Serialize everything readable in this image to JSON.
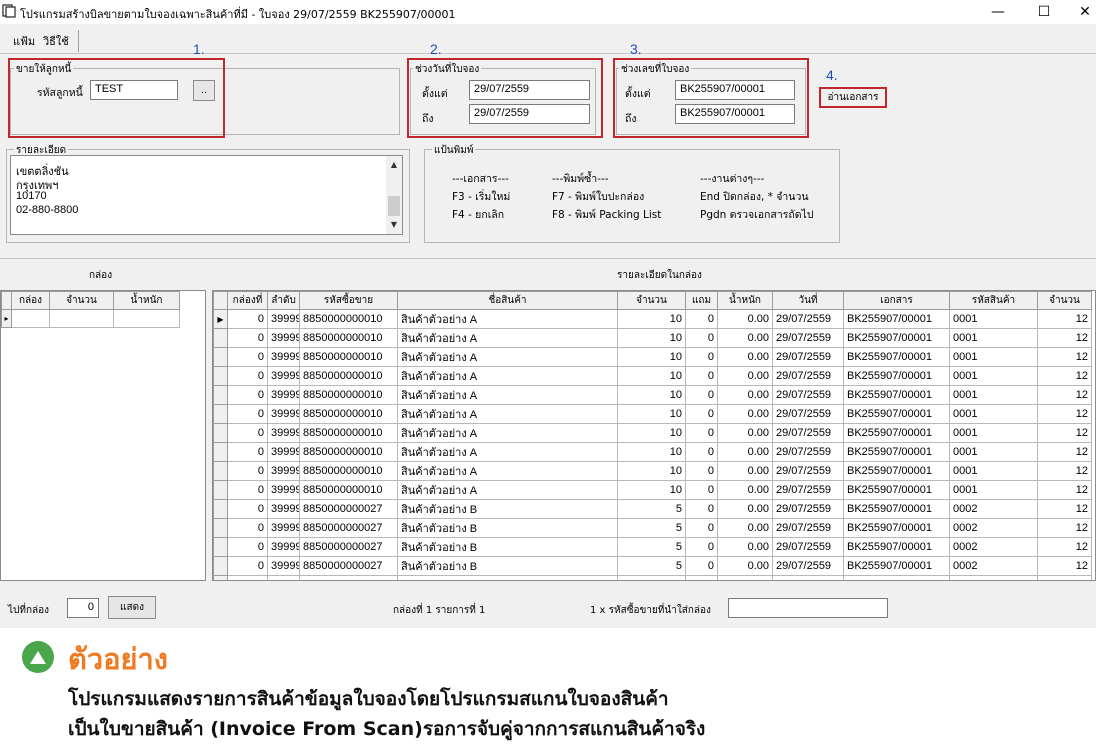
{
  "window": {
    "title": "โปรแกรมสร้างบิลขายตามใบจองเฉพาะสินค้าที่มี - ใบจอง 29/07/2559 BK255907/00001",
    "minimize": "—",
    "maximize": "☐",
    "close": "✕"
  },
  "menu": {
    "file": "แฟ้ม",
    "howto": "วิธีใช้"
  },
  "markers": {
    "m1": "1.",
    "m2": "2.",
    "m3": "3.",
    "m4": "4."
  },
  "customer": {
    "legend": "ขายให้ลูกหนี้",
    "code_label": "รหัสลูกหนี้",
    "code_value": "TEST",
    "browse_label": ".."
  },
  "date_range": {
    "legend": "ช่วงวันที่ใบจอง",
    "from_label": "ตั้งแต่",
    "from_value": "29/07/2559",
    "to_label": "ถึง",
    "to_value": "29/07/2559"
  },
  "doc_range": {
    "legend": "ช่วงเลขที่ใบจอง",
    "from_label": "ตั้งแต่",
    "from_value": "BK255907/00001",
    "to_label": "ถึง",
    "to_value": "BK255907/00001"
  },
  "read_button": "อ่านเอกสาร",
  "detail": {
    "legend": "รายละเอียด",
    "lines": [
      "เขตตลิ่งชัน",
      "กรุงเทพฯ",
      "10170",
      "02-880-8800"
    ]
  },
  "shortcuts": {
    "legend": "แป้นพิมพ์",
    "col1_header": "---เอกสาร---",
    "col1_a": "F3 - เริ่มใหม่",
    "col1_b": "F4 - ยกเลิก",
    "col2_header": "---พิมพ์ซ้ำ---",
    "col2_a": "F7 - พิมพ์ใบปะกล่อง",
    "col2_b": "F8 - พิมพ์ Packing List",
    "col3_header": "---งานต่างๆ---",
    "col3_a": "End ปิดกล่อง, * จำนวน",
    "col3_b": "Pgdn ตรวจเอกสารถัดไป"
  },
  "box_section": {
    "title": "กล่อง",
    "columns": [
      "กล่อง",
      "จำนวน",
      "น้ำหนัก"
    ]
  },
  "detail_section": {
    "title": "รายละเอียดในกล่อง",
    "columns": [
      "กล่องที่",
      "ลำดับ",
      "รหัสซื้อขาย",
      "ชื่อสินค้า",
      "จำนวน",
      "แถม",
      "น้ำหนัก",
      "วันที่",
      "เอกสาร",
      "รหัสสินค้า",
      "จำนวน"
    ],
    "rows": [
      [
        "0",
        "39999",
        "8850000000010",
        "สินค้าตัวอย่าง A",
        "10",
        "0",
        "0.00",
        "29/07/2559",
        "BK255907/00001",
        "0001",
        "12"
      ],
      [
        "0",
        "39999",
        "8850000000010",
        "สินค้าตัวอย่าง A",
        "10",
        "0",
        "0.00",
        "29/07/2559",
        "BK255907/00001",
        "0001",
        "12"
      ],
      [
        "0",
        "39999",
        "8850000000010",
        "สินค้าตัวอย่าง A",
        "10",
        "0",
        "0.00",
        "29/07/2559",
        "BK255907/00001",
        "0001",
        "12"
      ],
      [
        "0",
        "39999",
        "8850000000010",
        "สินค้าตัวอย่าง A",
        "10",
        "0",
        "0.00",
        "29/07/2559",
        "BK255907/00001",
        "0001",
        "12"
      ],
      [
        "0",
        "39999",
        "8850000000010",
        "สินค้าตัวอย่าง A",
        "10",
        "0",
        "0.00",
        "29/07/2559",
        "BK255907/00001",
        "0001",
        "12"
      ],
      [
        "0",
        "39999",
        "8850000000010",
        "สินค้าตัวอย่าง A",
        "10",
        "0",
        "0.00",
        "29/07/2559",
        "BK255907/00001",
        "0001",
        "12"
      ],
      [
        "0",
        "39999",
        "8850000000010",
        "สินค้าตัวอย่าง A",
        "10",
        "0",
        "0.00",
        "29/07/2559",
        "BK255907/00001",
        "0001",
        "12"
      ],
      [
        "0",
        "39999",
        "8850000000010",
        "สินค้าตัวอย่าง A",
        "10",
        "0",
        "0.00",
        "29/07/2559",
        "BK255907/00001",
        "0001",
        "12"
      ],
      [
        "0",
        "39999",
        "8850000000010",
        "สินค้าตัวอย่าง A",
        "10",
        "0",
        "0.00",
        "29/07/2559",
        "BK255907/00001",
        "0001",
        "12"
      ],
      [
        "0",
        "39999",
        "8850000000010",
        "สินค้าตัวอย่าง A",
        "10",
        "0",
        "0.00",
        "29/07/2559",
        "BK255907/00001",
        "0001",
        "12"
      ],
      [
        "0",
        "39999",
        "8850000000027",
        "สินค้าตัวอย่าง B",
        "5",
        "0",
        "0.00",
        "29/07/2559",
        "BK255907/00001",
        "0002",
        "12"
      ],
      [
        "0",
        "39999",
        "8850000000027",
        "สินค้าตัวอย่าง B",
        "5",
        "0",
        "0.00",
        "29/07/2559",
        "BK255907/00001",
        "0002",
        "12"
      ],
      [
        "0",
        "39999",
        "8850000000027",
        "สินค้าตัวอย่าง B",
        "5",
        "0",
        "0.00",
        "29/07/2559",
        "BK255907/00001",
        "0002",
        "12"
      ],
      [
        "0",
        "39999",
        "8850000000027",
        "สินค้าตัวอย่าง B",
        "5",
        "0",
        "0.00",
        "29/07/2559",
        "BK255907/00001",
        "0002",
        "12"
      ],
      [
        "0",
        "39999",
        "8850000000027",
        "สินค้าตัวอย่าง B",
        "5",
        "0",
        "0.00",
        "29/07/2559",
        "BK255907/00001",
        "0002",
        "12"
      ]
    ]
  },
  "bottom": {
    "goto_label": "ไปที่กล่อง",
    "goto_value": "0",
    "show_button": "แสดง",
    "status": "กล่องที่ 1 รายการที่ 1",
    "scan_label": "1 x  รหัสซื้อขายที่นำใส่กล่อง",
    "scan_value": ""
  },
  "caption": {
    "heading": "ตัวอย่าง",
    "line1": "โปรแกรมแสดงรายการสินค้าข้อมูลใบจองโดยโปรแกรมสแกนใบจองสินค้า",
    "line2": "เป็นใบขายสินค้า (Invoice From Scan)รอการจับคู่จากการสแกนสินค้าจริง"
  },
  "colors": {
    "marker_blue": "#1f4fb5",
    "highlight_red": "#c0282c",
    "heading_orange": "#f07a21",
    "badge_green": "#4aa64a"
  }
}
